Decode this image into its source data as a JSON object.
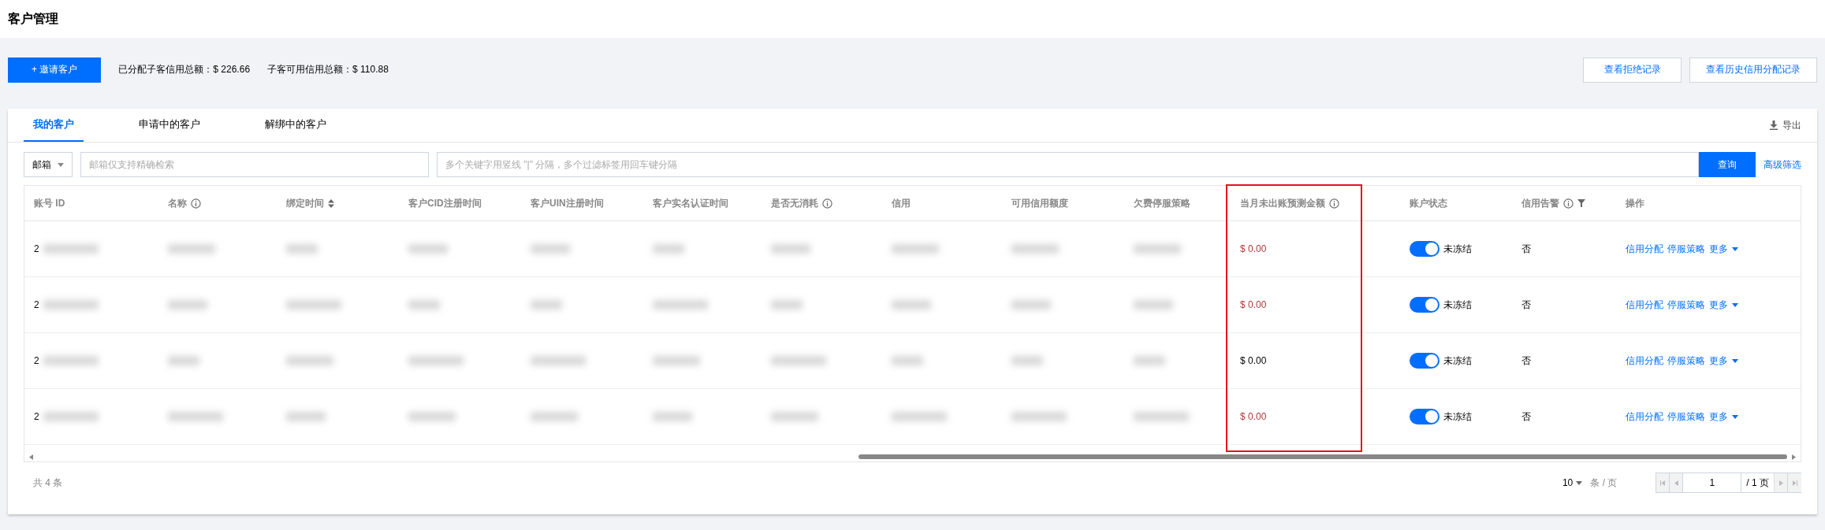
{
  "page_title": "客户管理",
  "toolbar": {
    "invite_button": "+ 邀请客户",
    "summaries": [
      "已分配子客信用总额：$ 226.66",
      "子客可用信用总额：$ 110.88"
    ],
    "buttons": [
      "查看拒绝记录",
      "查看历史信用分配记录"
    ]
  },
  "tabs": [
    {
      "label": "我的客户",
      "selected": true
    },
    {
      "label": "申请中的客户",
      "selected": false
    },
    {
      "label": "解绑中的客户",
      "selected": false
    }
  ],
  "export_button": "导出",
  "filter": {
    "select": "邮箱",
    "email_placeholder": "邮箱仅支持精确检索",
    "keyword_placeholder": "多个关键字用竖线 \"|\" 分隔，多个过滤标签用回车键分隔",
    "search_button": "查询",
    "advanced_link": "高级筛选"
  },
  "table": {
    "annotation": {
      "kind": "frame"
    },
    "columns": [
      {
        "label": "账号 ID",
        "kind": "account"
      },
      {
        "label": "名称",
        "kind": "redacted",
        "info": true
      },
      {
        "label": "绑定时间",
        "kind": "redacted",
        "sortable": true
      },
      {
        "label": "客户CID注册时间",
        "kind": "redacted"
      },
      {
        "label": "客户UIN注册时间",
        "kind": "redacted"
      },
      {
        "label": "客户实名认证时间",
        "kind": "redacted"
      },
      {
        "label": "是否无消耗",
        "kind": "redacted",
        "info": true
      },
      {
        "label": "信用",
        "kind": "redacted"
      },
      {
        "label": "可用信用额度",
        "kind": "redacted"
      },
      {
        "label": "欠费停服策略",
        "kind": "redacted"
      },
      {
        "label": "当月未出账预测金额",
        "kind": "amount",
        "info": true
      },
      {
        "label": "账户状态",
        "kind": "status"
      },
      {
        "label": "信用告警",
        "kind": "alert",
        "info": true,
        "filterable": true
      },
      {
        "label": "操作",
        "kind": "actions"
      }
    ],
    "rows": [
      {
        "account": "2",
        "amount": "$ 0.00",
        "amount_warning": true,
        "status_on": true,
        "status": "未冻结",
        "alert": "否",
        "actions": [
          "信用分配",
          "停服策略",
          "更多"
        ]
      },
      {
        "account": "2",
        "amount": "$ 0.00",
        "amount_warning": true,
        "status_on": true,
        "status": "未冻结",
        "alert": "否",
        "actions": [
          "信用分配",
          "停服策略",
          "更多"
        ]
      },
      {
        "account": "2",
        "amount": "$ 0.00",
        "amount_warning": false,
        "status_on": true,
        "status": "未冻结",
        "alert": "否",
        "actions": [
          "信用分配",
          "停服策略",
          "更多"
        ]
      },
      {
        "account": "2",
        "amount": "$ 0.00",
        "amount_warning": true,
        "status_on": true,
        "status": "未冻结",
        "alert": "否",
        "actions": [
          "信用分配",
          "停服策略",
          "更多"
        ]
      }
    ]
  },
  "footer": {
    "total": "共 4 条",
    "page_size": "10",
    "page_size_unit": "条 / 页",
    "page": "1",
    "page_total": "/ 1 页"
  }
}
